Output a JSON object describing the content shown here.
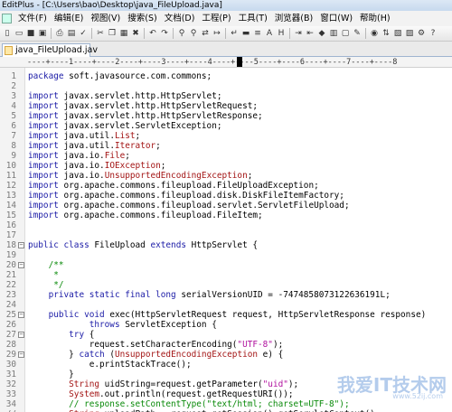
{
  "window": {
    "title": "EditPlus - [C:\\Users\\bao\\Desktop\\java_FileUpload.java]"
  },
  "menu": [
    "文件(F)",
    "编辑(E)",
    "视图(V)",
    "搜索(S)",
    "文档(D)",
    "工程(P)",
    "工具(T)",
    "浏览器(B)",
    "窗口(W)",
    "帮助(H)"
  ],
  "toolbar": {
    "buttons": [
      {
        "name": "new-file-icon",
        "glyph": "▯"
      },
      {
        "name": "open-icon",
        "glyph": "▭"
      },
      {
        "name": "save-icon",
        "glyph": "■"
      },
      {
        "name": "save-all-icon",
        "glyph": "▣"
      },
      {
        "sep": true
      },
      {
        "name": "print-icon",
        "glyph": "⎙"
      },
      {
        "name": "print-preview-icon",
        "glyph": "▤"
      },
      {
        "name": "spell-check-icon",
        "glyph": "✓"
      },
      {
        "sep": true
      },
      {
        "name": "cut-icon",
        "glyph": "✂"
      },
      {
        "name": "copy-icon",
        "glyph": "❐"
      },
      {
        "name": "paste-icon",
        "glyph": "▦"
      },
      {
        "name": "delete-icon",
        "glyph": "✖"
      },
      {
        "sep": true
      },
      {
        "name": "undo-icon",
        "glyph": "↶"
      },
      {
        "name": "redo-icon",
        "glyph": "↷"
      },
      {
        "sep": true
      },
      {
        "name": "find-icon",
        "glyph": "⚲"
      },
      {
        "name": "find-next-icon",
        "glyph": "⚲"
      },
      {
        "name": "replace-icon",
        "glyph": "⇄"
      },
      {
        "name": "goto-icon",
        "glyph": "↦"
      },
      {
        "sep": true
      },
      {
        "name": "word-wrap-icon",
        "glyph": "↵"
      },
      {
        "name": "ruler-icon",
        "glyph": "▬"
      },
      {
        "name": "line-number-icon",
        "glyph": "≡"
      },
      {
        "name": "font-icon",
        "glyph": "A"
      },
      {
        "name": "hex-icon",
        "glyph": "H"
      },
      {
        "sep": true
      },
      {
        "name": "indent-icon",
        "glyph": "⇥"
      },
      {
        "name": "outdent-icon",
        "glyph": "⇤"
      },
      {
        "name": "bookmark-icon",
        "glyph": "◆"
      },
      {
        "name": "column-select-icon",
        "glyph": "▥"
      },
      {
        "name": "view-toggle-icon",
        "glyph": "▢"
      },
      {
        "name": "preferences-icon",
        "glyph": "✎"
      },
      {
        "sep": true
      },
      {
        "name": "browser-icon",
        "glyph": "◉"
      },
      {
        "name": "ftp-icon",
        "glyph": "⇅"
      },
      {
        "name": "cliptext-icon",
        "glyph": "▧"
      },
      {
        "name": "directory-icon",
        "glyph": "▨"
      },
      {
        "name": "user-tool-icon",
        "glyph": "⚙"
      },
      {
        "name": "help-icon",
        "glyph": "?"
      }
    ]
  },
  "tabs": [
    {
      "label": "java_FileUpload.jav"
    }
  ],
  "ruler": {
    "text": "----+----1----+----2----+----3----+----4----+----5----+----6----+----7----+----8"
  },
  "lines": [
    {
      "n": "1",
      "segs": [
        [
          "kw",
          "package"
        ],
        [
          "plain",
          " soft.javasource.com.commons;"
        ]
      ]
    },
    {
      "n": "2",
      "segs": []
    },
    {
      "n": "3",
      "segs": [
        [
          "kw",
          "import"
        ],
        [
          "plain",
          " javax.servlet.http.HttpServlet;"
        ]
      ]
    },
    {
      "n": "4",
      "segs": [
        [
          "kw",
          "import"
        ],
        [
          "plain",
          " javax.servlet.http.HttpServletRequest;"
        ]
      ]
    },
    {
      "n": "5",
      "segs": [
        [
          "kw",
          "import"
        ],
        [
          "plain",
          " javax.servlet.http.HttpServletResponse;"
        ]
      ]
    },
    {
      "n": "6",
      "segs": [
        [
          "kw",
          "import"
        ],
        [
          "plain",
          " javax.servlet.ServletException;"
        ]
      ]
    },
    {
      "n": "7",
      "segs": [
        [
          "kw",
          "import"
        ],
        [
          "plain",
          " java.util."
        ],
        [
          "cls",
          "List"
        ],
        [
          "plain",
          ";"
        ]
      ]
    },
    {
      "n": "8",
      "segs": [
        [
          "kw",
          "import"
        ],
        [
          "plain",
          " java.util."
        ],
        [
          "cls",
          "Iterator"
        ],
        [
          "plain",
          ";"
        ]
      ]
    },
    {
      "n": "9",
      "segs": [
        [
          "kw",
          "import"
        ],
        [
          "plain",
          " java.io."
        ],
        [
          "cls",
          "File"
        ],
        [
          "plain",
          ";"
        ]
      ]
    },
    {
      "n": "10",
      "segs": [
        [
          "kw",
          "import"
        ],
        [
          "plain",
          " java.io."
        ],
        [
          "cls",
          "IOException"
        ],
        [
          "plain",
          ";"
        ]
      ]
    },
    {
      "n": "11",
      "segs": [
        [
          "kw",
          "import"
        ],
        [
          "plain",
          " java.io."
        ],
        [
          "cls",
          "UnsupportedEncodingException"
        ],
        [
          "plain",
          ";"
        ]
      ]
    },
    {
      "n": "12",
      "segs": [
        [
          "kw",
          "import"
        ],
        [
          "plain",
          " org.apache.commons.fileupload.FileUploadException;"
        ]
      ]
    },
    {
      "n": "13",
      "segs": [
        [
          "kw",
          "import"
        ],
        [
          "plain",
          " org.apache.commons.fileupload.disk.DiskFileItemFactory;"
        ]
      ]
    },
    {
      "n": "14",
      "segs": [
        [
          "kw",
          "import"
        ],
        [
          "plain",
          " org.apache.commons.fileupload.servlet.ServletFileUpload;"
        ]
      ]
    },
    {
      "n": "15",
      "segs": [
        [
          "kw",
          "import"
        ],
        [
          "plain",
          " org.apache.commons.fileupload.FileItem;"
        ]
      ]
    },
    {
      "n": "16",
      "segs": []
    },
    {
      "n": "17",
      "segs": []
    },
    {
      "n": "18",
      "fold": "−",
      "segs": [
        [
          "kw",
          "public class"
        ],
        [
          "plain",
          " FileUpload "
        ],
        [
          "kw",
          "extends"
        ],
        [
          "plain",
          " HttpServlet {"
        ]
      ]
    },
    {
      "n": "19",
      "segs": []
    },
    {
      "n": "20",
      "fold": "−",
      "segs": [
        [
          "cmt",
          "    /**"
        ]
      ]
    },
    {
      "n": "21",
      "segs": [
        [
          "cmt",
          "     *"
        ]
      ]
    },
    {
      "n": "22",
      "segs": [
        [
          "cmt",
          "     */"
        ]
      ]
    },
    {
      "n": "23",
      "segs": [
        [
          "kw",
          "    private static final long"
        ],
        [
          "plain",
          " serialVersionUID = -7474858073122636191L;"
        ]
      ]
    },
    {
      "n": "24",
      "segs": []
    },
    {
      "n": "25",
      "fold": "−",
      "segs": [
        [
          "kw",
          "    public void"
        ],
        [
          "plain",
          " exec(HttpServletRequest request, HttpServletResponse response)"
        ]
      ]
    },
    {
      "n": "26",
      "segs": [
        [
          "kw",
          "            throws"
        ],
        [
          "plain",
          " ServletException {"
        ]
      ]
    },
    {
      "n": "27",
      "fold": "−",
      "segs": [
        [
          "kw",
          "        try"
        ],
        [
          "plain",
          " {"
        ]
      ]
    },
    {
      "n": "28",
      "segs": [
        [
          "plain",
          "            request.setCharacterEncoding("
        ],
        [
          "str",
          "\"UTF-8\""
        ],
        [
          "plain",
          ");"
        ]
      ]
    },
    {
      "n": "29",
      "fold": "−",
      "segs": [
        [
          "plain",
          "        } "
        ],
        [
          "kw",
          "catch"
        ],
        [
          "plain",
          " ("
        ],
        [
          "cls",
          "UnsupportedEncodingException"
        ],
        [
          "plain",
          " e) {"
        ]
      ]
    },
    {
      "n": "30",
      "segs": [
        [
          "plain",
          "            e.printStackTrace();"
        ]
      ]
    },
    {
      "n": "31",
      "segs": [
        [
          "plain",
          "        }"
        ]
      ]
    },
    {
      "n": "32",
      "segs": [
        [
          "cls",
          "        String"
        ],
        [
          "plain",
          " uidString=request.getParameter("
        ],
        [
          "str",
          "\"uid\""
        ],
        [
          "plain",
          ");"
        ]
      ]
    },
    {
      "n": "33",
      "segs": [
        [
          "cls",
          "        System"
        ],
        [
          "plain",
          ".out.println(request.getRequestURI());"
        ]
      ]
    },
    {
      "n": "34",
      "segs": [
        [
          "cmt",
          "        // response.setContentType(\"text/html; charset=UTF-8\");"
        ]
      ]
    },
    {
      "n": "//",
      "segs": [
        [
          "cls",
          "        String"
        ],
        [
          "plain",
          " uploadPath = request.getSession().getServletContext()"
        ]
      ]
    }
  ],
  "watermark": {
    "text": "我爱IT技术网",
    "url": "www.52ij.com"
  }
}
